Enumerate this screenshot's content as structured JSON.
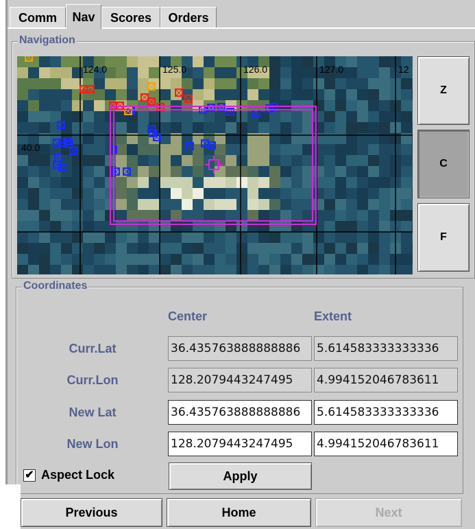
{
  "tabs": [
    {
      "label": "Comm",
      "selected": false
    },
    {
      "label": "Nav",
      "selected": true
    },
    {
      "label": "Scores",
      "selected": false
    },
    {
      "label": "Orders",
      "selected": false
    }
  ],
  "navigation": {
    "title": "Navigation",
    "grid_lon_labels": [
      "124.0",
      "125.0",
      "126.0",
      "127.0",
      "12"
    ],
    "grid_lat_labels": [
      "40.0"
    ],
    "zoom_buttons": [
      {
        "label": "Z",
        "pressed": false
      },
      {
        "label": "C",
        "pressed": true
      },
      {
        "label": "F",
        "pressed": false
      }
    ],
    "colors": {
      "extent_box": "#e020e0",
      "blue_unit": "#1a2cff",
      "red_unit": "#ff1a1a",
      "orange_unit": "#f0a000"
    }
  },
  "coordinates": {
    "title": "Coordinates",
    "col_center": "Center",
    "col_extent": "Extent",
    "rows": [
      {
        "label": "Curr.Lat",
        "center": "36.435763888888886",
        "extent": "5.614583333333336",
        "editable": false
      },
      {
        "label": "Curr.Lon",
        "center": "128.2079443247495",
        "extent": "4.994152046783611",
        "editable": false
      },
      {
        "label": "New Lat",
        "center": "36.435763888888886",
        "extent": "5.614583333333336",
        "editable": true
      },
      {
        "label": "New Lon",
        "center": "128.2079443247495",
        "extent": "4.994152046783611",
        "editable": true
      }
    ],
    "aspect_lock_label": "Aspect Lock",
    "aspect_lock_checked": true,
    "apply_label": "Apply"
  },
  "bottom_buttons": {
    "previous": "Previous",
    "home": "Home",
    "next": "Next",
    "next_enabled": false
  }
}
